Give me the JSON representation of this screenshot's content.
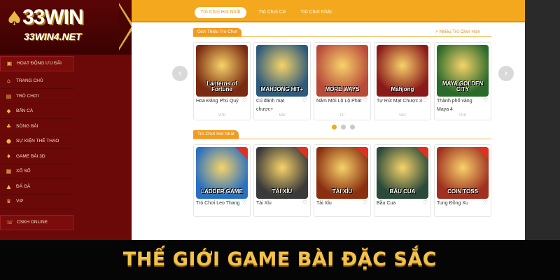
{
  "logo": {
    "title": "33WIN",
    "subtitle": "33WIN4.NET",
    "spade_icon": "spade-icon"
  },
  "sidebar": {
    "items": [
      {
        "label": "HOẠT ĐỘNG ƯU ĐÃI",
        "icon": "gift-icon"
      },
      {
        "label": "TRANG CHỦ",
        "icon": "home-icon"
      },
      {
        "label": "TRÒ CHƠI",
        "icon": "slot-icon"
      },
      {
        "label": "BẮN CÁ",
        "icon": "fish-icon"
      },
      {
        "label": "SÒNG BÀI",
        "icon": "casino-icon"
      },
      {
        "label": "SỰ KIỆN THỂ THAO",
        "icon": "ball-icon"
      },
      {
        "label": "GAME BÀI 3D",
        "icon": "cards-icon"
      },
      {
        "label": "XỔ SỐ",
        "icon": "lottery-icon"
      },
      {
        "label": "ĐÁ GÀ",
        "icon": "rooster-icon"
      },
      {
        "label": "VIP",
        "icon": "crown-icon"
      },
      {
        "label": "CSKH ONLINE",
        "icon": "headset-icon"
      }
    ]
  },
  "tabs": [
    {
      "label": "Trò Chơi Hot Nhất"
    },
    {
      "label": "Trò Chơi Cờ"
    },
    {
      "label": "Trò Chơi Khác"
    }
  ],
  "intro_section": {
    "label": "Giới Thiệu Trò Chơi",
    "more": "> Nhiều Trò Chơi Hơn"
  },
  "hot_section": {
    "label": "Trò Chơi Hot Nhất"
  },
  "intro_cards": [
    {
      "name": "Hoa Đăng Phú Quý",
      "provider": "VDR",
      "thumb_text": "Lanterns of Fortune",
      "color": "#7a2a10"
    },
    {
      "name": "Cú đánh mạt chược+",
      "provider": "MW",
      "thumb_text": "MAHJONG HIT+",
      "color": "#2d5a7a"
    },
    {
      "name": "Năm Mới Lộ Lộ Phát",
      "provider": "FC",
      "thumb_text": "MORE WAYS",
      "color": "#b84a3a"
    },
    {
      "name": "Tự Rút Mạt Chược 3",
      "provider": "VAG",
      "thumb_text": "Mahjong",
      "color": "#8a1a1a"
    },
    {
      "name": "Thành phố vàng Maya 4",
      "provider": "VDR",
      "thumb_text": "MAYA GOLDEN CITY",
      "color": "#2a6a2a"
    }
  ],
  "hot_cards": [
    {
      "name": "Trò Chơi Leo Thang",
      "thumb_text": "LADDER GAME",
      "color": "#2a70c0"
    },
    {
      "name": "Tài Xỉu",
      "thumb_text": "TÀI XỈU",
      "color": "#3a3a3a"
    },
    {
      "name": "Tài Xỉu",
      "thumb_text": "TÀI XỈU",
      "color": "#8a3010"
    },
    {
      "name": "Bầu Cua",
      "thumb_text": "BẦU CUA",
      "color": "#2a4a3a"
    },
    {
      "name": "Tung Đồng Xu",
      "thumb_text": "COIN TOSS",
      "color": "#a03020"
    }
  ],
  "carousel": {
    "pages": 3,
    "active": 0
  },
  "banner": {
    "text": "THẾ GIỚI GAME BÀI ĐẶC SẮC"
  },
  "colors": {
    "accent": "#f3a81e",
    "sidebar": "#6b0808",
    "banner_text": "#f2c24a"
  }
}
